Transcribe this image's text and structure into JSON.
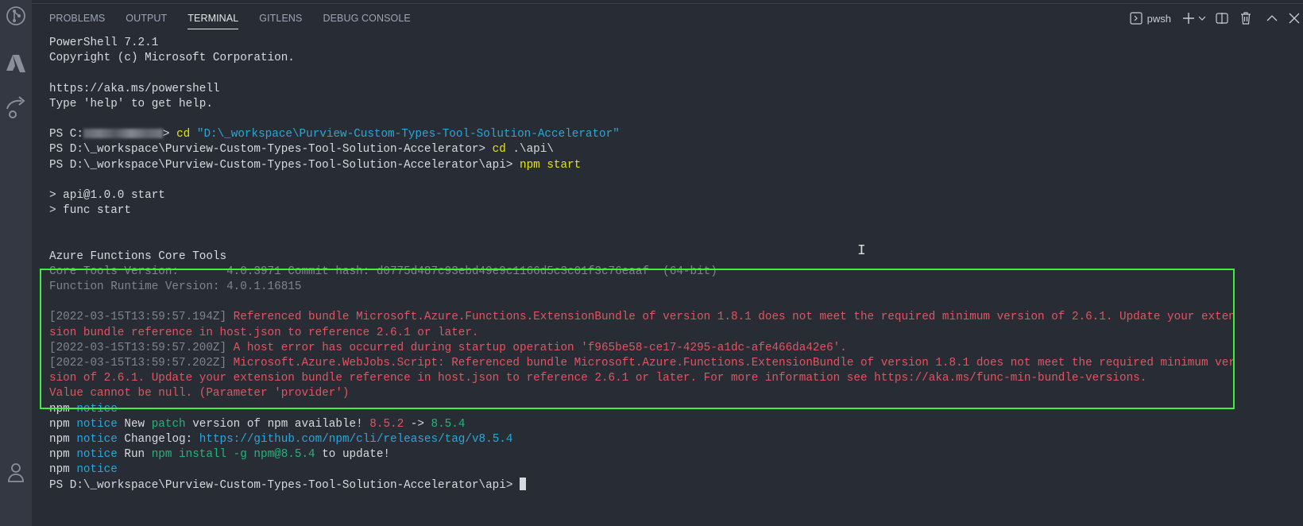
{
  "panel": {
    "tabs": [
      {
        "label": "PROBLEMS"
      },
      {
        "label": "OUTPUT"
      },
      {
        "label": "TERMINAL",
        "active": true
      },
      {
        "label": "GITLENS"
      },
      {
        "label": "DEBUG CONSOLE"
      }
    ],
    "shell_name": "pwsh"
  },
  "terminal": {
    "l1": "PowerShell 7.2.1",
    "l2": "Copyright (c) Microsoft Corporation.",
    "l3": "https://aka.ms/powershell",
    "l4": "Type 'help' to get help.",
    "p1_prefix": "PS C:",
    "p1_suffix": ">",
    "p1_cmd": "cd",
    "p1_arg": "\"D:\\_workspace\\Purview-Custom-Types-Tool-Solution-Accelerator\"",
    "p2_prompt": "PS D:\\_workspace\\Purview-Custom-Types-Tool-Solution-Accelerator> ",
    "p2_cmd": "cd",
    "p2_arg": " .\\api\\",
    "p3_prompt": "PS D:\\_workspace\\Purview-Custom-Types-Tool-Solution-Accelerator\\api> ",
    "p3_cmd": "npm start",
    "s1": "> api@1.0.0 start",
    "s2": "> func start",
    "az_title": "Azure Functions Core Tools",
    "core_version": "Core Tools Version:       4.0.3971 Commit hash: d0775d487c93ebd49e9c1166d5c3c01f3c76eaaf  (64-bit)",
    "runtime_version": "Function Runtime Version: 4.0.1.16815",
    "err1a": "[2022-03-15T13:59:57.194Z] ",
    "err1b": "Referenced bundle Microsoft.Azure.Functions.ExtensionBundle of version 1.8.1 does not meet the required minimum version of 2.6.1. Update your exten",
    "err1c": "sion bundle reference in host.json to reference 2.6.1 or later.",
    "err2a": "[2022-03-15T13:59:57.200Z] ",
    "err2b": "A host error has occurred during startup operation 'f965be58-ce17-4295-a1dc-afe466da42e6'.",
    "err3a": "[2022-03-15T13:59:57.202Z] ",
    "err3b": "Microsoft.Azure.WebJobs.Script: Referenced bundle Microsoft.Azure.Functions.ExtensionBundle of version 1.8.1 does not meet the required minimum ver",
    "err3c": "sion of 2.6.1. Update your extension bundle reference in host.json to reference 2.6.1 or later. For more information see https://aka.ms/func-min-bundle-versions.",
    "err4": "Value cannot be null. (Parameter 'provider')",
    "npm": "npm",
    "notice": " notice",
    "n2_a": " New ",
    "n2_patch": "patch",
    "n2_b": " version of npm available! ",
    "n2_old": "8.5.2",
    "n2_arrow": " -> ",
    "n2_new": "8.5.4",
    "n3_a": " Changelog: ",
    "n3_url": "https://github.com/npm/cli/releases/tag/v8.5.4",
    "n4_a": " Run ",
    "n4_cmd": "npm install -g npm@8.5.4",
    "n4_b": " to update!",
    "final_prompt": "PS D:\\_workspace\\Purview-Custom-Types-Tool-Solution-Accelerator\\api> "
  },
  "colors": {
    "background": "#282c34",
    "error": "#e05561",
    "highlight_box": "#3df03d"
  }
}
